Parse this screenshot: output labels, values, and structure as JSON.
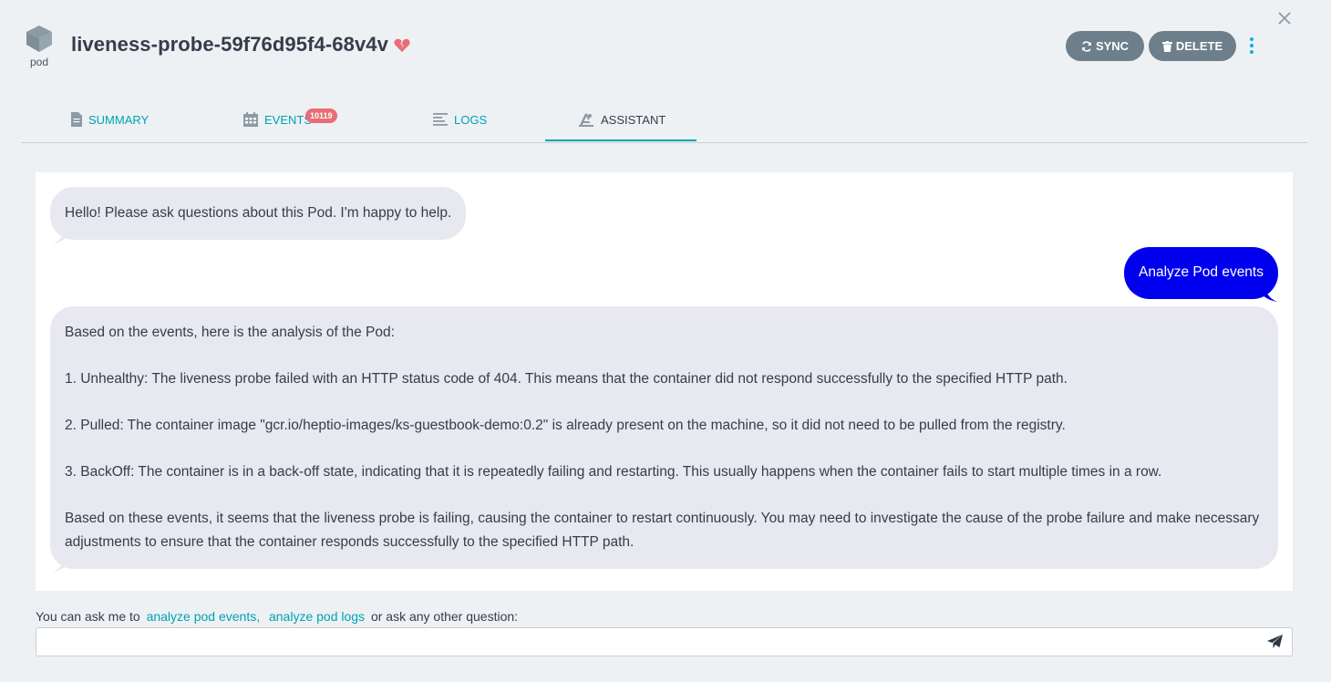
{
  "header": {
    "kind_label": "pod",
    "title": "liveness-probe-59f76d95f4-68v4v",
    "sync_label": "SYNC",
    "delete_label": "DELETE"
  },
  "tabs": [
    {
      "label": "SUMMARY",
      "icon": "file-icon"
    },
    {
      "label": "EVENTS",
      "icon": "calendar-icon",
      "badge": "10119"
    },
    {
      "label": "LOGS",
      "icon": "align-left-icon"
    },
    {
      "label": "ASSISTANT",
      "icon": "assistant-icon",
      "active": true
    }
  ],
  "chat": {
    "messages": [
      {
        "from": "bot",
        "text": "Hello! Please ask questions about this Pod. I'm happy to help."
      },
      {
        "from": "user",
        "text": "Analyze Pod events"
      },
      {
        "from": "bot",
        "text": "Based on the events, here is the analysis of the Pod:\n\n1. Unhealthy: The liveness probe failed with an HTTP status code of 404. This means that the container did not respond successfully to the specified HTTP path.\n\n2. Pulled: The container image \"gcr.io/heptio-images/ks-guestbook-demo:0.2\" is already present on the machine, so it did not need to be pulled from the registry.\n\n3. BackOff: The container is in a back-off state, indicating that it is repeatedly failing and restarting. This usually happens when the container fails to start multiple times in a row.\n\nBased on these events, it seems that the liveness probe is failing, causing the container to restart continuously. You may need to investigate the cause of the probe failure and make necessary adjustments to ensure that the container responds successfully to the specified HTTP path."
      }
    ]
  },
  "footer": {
    "hint_prefix": "You can ask me to",
    "suggestion_1": "analyze pod events,",
    "suggestion_2": "analyze pod logs",
    "hint_suffix": "or ask any other question:",
    "input_value": ""
  },
  "colors": {
    "accent": "#00a2b3",
    "user_bubble": "#0000ee",
    "bot_bubble": "#e8e8f1",
    "button": "#6d7f8b",
    "badge": "#e96d76",
    "health_degraded": "#e96d76"
  }
}
